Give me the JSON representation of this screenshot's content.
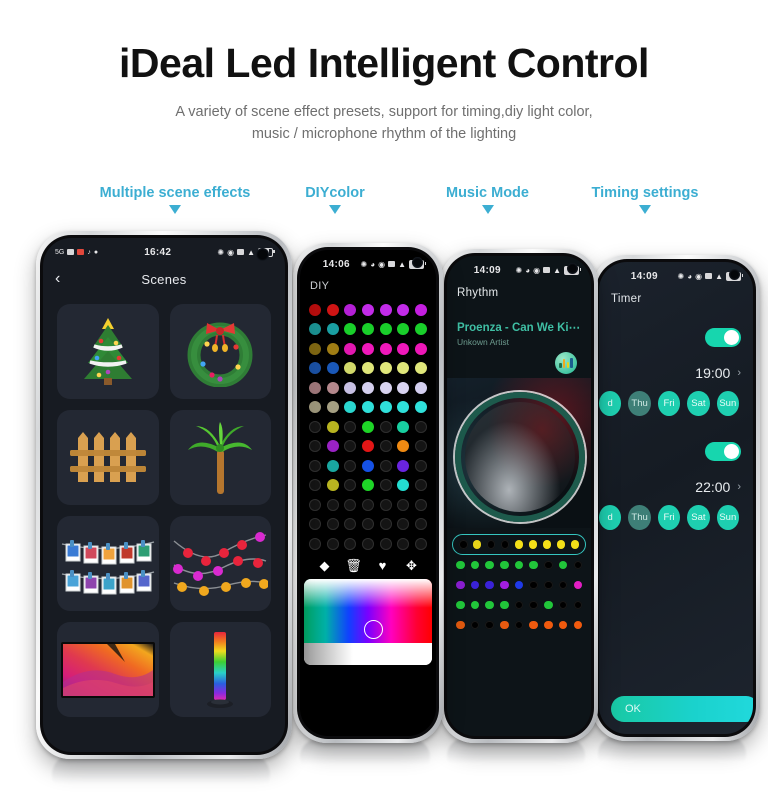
{
  "header": {
    "title": "iDeal Led Intelligent Control",
    "subtitle_line1": "A variety of scene effect presets, support for timing,diy light color,",
    "subtitle_line2": "music / microphone rhythm of the lighting",
    "accent_color": "#3caed2"
  },
  "callouts": [
    {
      "label": "Multiple scene effects"
    },
    {
      "label": "DIYcolor"
    },
    {
      "label": "Music Mode"
    },
    {
      "label": "Timing settings"
    }
  ],
  "phones": {
    "scenes": {
      "status": {
        "time": "16:42",
        "battery": "63",
        "network": "5G"
      },
      "nav": {
        "back": "‹",
        "title": "Scenes"
      },
      "tiles": [
        {
          "name": "christmas-tree"
        },
        {
          "name": "christmas-wreath"
        },
        {
          "name": "wooden-fence"
        },
        {
          "name": "palm-tree"
        },
        {
          "name": "photo-clip-string"
        },
        {
          "name": "string-lights"
        },
        {
          "name": "colorful-tv-screen"
        },
        {
          "name": "rgb-light-bar"
        }
      ]
    },
    "diy": {
      "status": {
        "time": "14:06",
        "battery": "100"
      },
      "nav": {
        "title": "DIY"
      },
      "tools": [
        {
          "name": "eraser-icon",
          "glyph": "◆"
        },
        {
          "name": "trash-icon",
          "glyph": "🗑"
        },
        {
          "name": "heart-icon",
          "glyph": "♥"
        },
        {
          "name": "move-icon",
          "glyph": "✥"
        }
      ],
      "grid_rows": [
        [
          "#b30d0d",
          "#cf1414",
          "#b41fd6",
          "#c22be8",
          "#c22be8",
          "#c22be8",
          "#c41ee0"
        ],
        [
          "#1b8f90",
          "#1a9fa2",
          "#19cf2a",
          "#19cf2a",
          "#19cf2a",
          "#19cf2a",
          "#19cf2a"
        ],
        [
          "#7d6512",
          "#a07d14",
          "#e217b0",
          "#f018bb",
          "#f018bb",
          "#f018bb",
          "#ee16b7"
        ],
        [
          "#1a4fa0",
          "#1a58b8",
          "#d2d96a",
          "#e0e77a",
          "#e0e77a",
          "#e0e77a",
          "#e0e77a"
        ],
        [
          "#9c7578",
          "#b4888c",
          "#c6bfe2",
          "#d5cfee",
          "#d8d3f0",
          "#d8d3f0",
          "#d4cff0"
        ],
        [
          "#9a9479",
          "#a59f82",
          "#2ad6cf",
          "#2fe0da",
          "#2fe0da",
          "#2fe0da",
          "#2fe0da"
        ],
        [
          "#000000",
          "#b8b420",
          "#000000",
          "#1ed527",
          "#000000",
          "#18cfa0",
          "#000000"
        ],
        [
          "#000000",
          "#9a22c4",
          "#000000",
          "#e31616",
          "#000000",
          "#f08a12",
          "#000000"
        ],
        [
          "#000000",
          "#19a7a0",
          "#000000",
          "#1551e6",
          "#000000",
          "#6a24e0",
          "#000000"
        ],
        [
          "#000000",
          "#b8b420",
          "#000000",
          "#1ed527",
          "#000000",
          "#23dcd0",
          "#000000"
        ],
        [
          "#000000",
          "#000000",
          "#000000",
          "#000000",
          "#000000",
          "#000000",
          "#000000"
        ],
        [
          "#000000",
          "#000000",
          "#000000",
          "#000000",
          "#000000",
          "#000000",
          "#000000"
        ],
        [
          "#000000",
          "#000000",
          "#000000",
          "#000000",
          "#000000",
          "#000000",
          "#000000"
        ]
      ]
    },
    "rhythm": {
      "status": {
        "time": "14:09",
        "battery": "100"
      },
      "nav": {
        "title": "Rhythm"
      },
      "track_name": "Proenza - Can We Ki⋯",
      "track_artist": "Unkown Artist",
      "eq_icon": "equalizer-icon",
      "rows": [
        {
          "selected": true,
          "dots": [
            "#000000",
            "#e8d419",
            "#000000",
            "#000000",
            "#f4e018",
            "#f4e018",
            "#f4e018",
            "#f4e018",
            "#f4e018"
          ]
        },
        {
          "selected": false,
          "dots": [
            "#21c63a",
            "#21c63a",
            "#21c63a",
            "#21c63a",
            "#21c63a",
            "#21c63a",
            "#000000",
            "#21c63a",
            "#000000"
          ]
        },
        {
          "selected": false,
          "dots": [
            "#8a1ed0",
            "#3a22d8",
            "#3a22d8",
            "#a31ee0",
            "#1f3ae8",
            "#000000",
            "#000000",
            "#000000",
            "#e31ec4"
          ]
        },
        {
          "selected": false,
          "dots": [
            "#21c63a",
            "#21c63a",
            "#21c63a",
            "#21c63a",
            "#000000",
            "#000000",
            "#21c63a",
            "#000000",
            "#000000"
          ]
        },
        {
          "selected": false,
          "dots": [
            "#e0590f",
            "#000000",
            "#000000",
            "#e85a10",
            "#000000",
            "#f05a0e",
            "#f05a0e",
            "#f05a0e",
            "#f05a0e"
          ]
        }
      ]
    },
    "timer": {
      "status": {
        "time": "14:09",
        "battery": "100"
      },
      "nav": {
        "title": "Timer"
      },
      "entries": [
        {
          "enabled": true,
          "time": "19:00",
          "chevron": "›",
          "days": [
            {
              "label": "d",
              "active": true
            },
            {
              "label": "Thu",
              "active": false
            },
            {
              "label": "Fri",
              "active": true
            },
            {
              "label": "Sat",
              "active": true
            },
            {
              "label": "Sun",
              "active": true
            }
          ]
        },
        {
          "enabled": true,
          "time": "22:00",
          "chevron": "›",
          "days": [
            {
              "label": "d",
              "active": true
            },
            {
              "label": "Thu",
              "active": false
            },
            {
              "label": "Fri",
              "active": true
            },
            {
              "label": "Sat",
              "active": true
            },
            {
              "label": "Sun",
              "active": true
            }
          ]
        }
      ],
      "ok_label": "OK",
      "accent": "#1ecfb0"
    }
  }
}
